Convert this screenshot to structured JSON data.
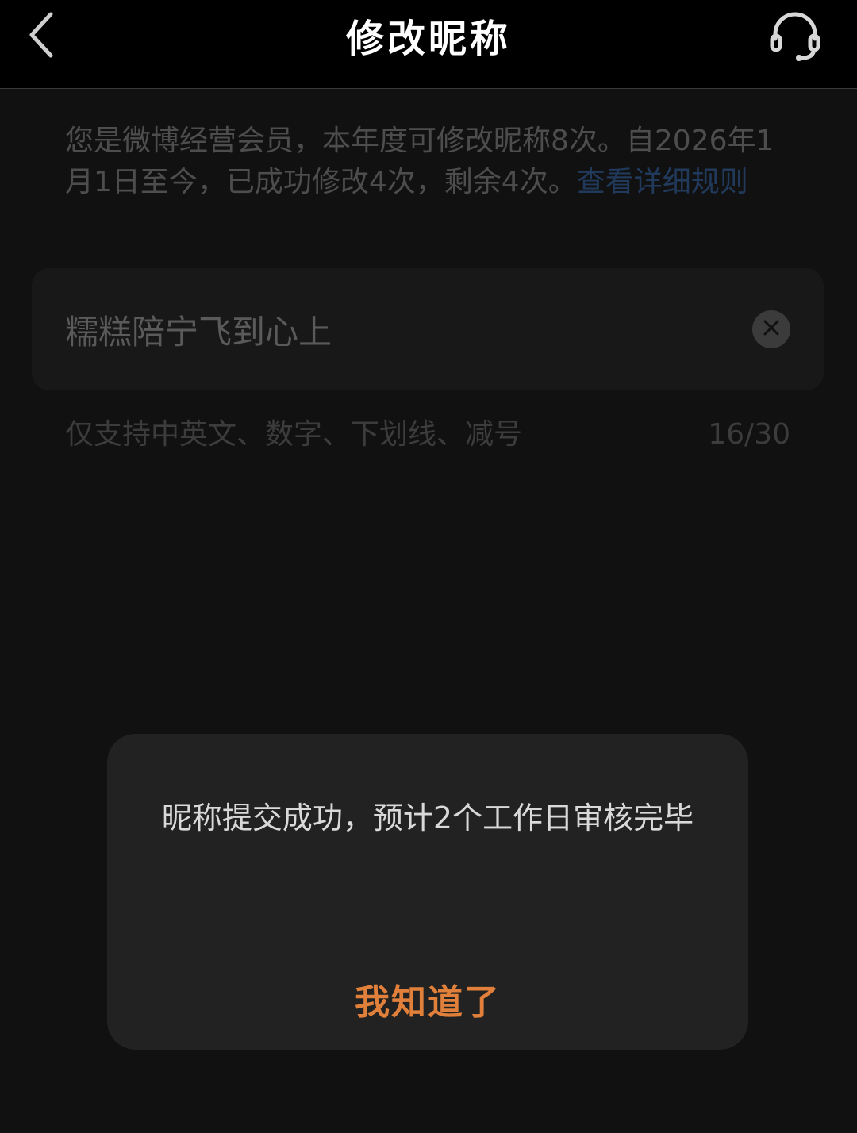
{
  "header": {
    "title": "修改昵称",
    "back_icon": "chevron-left-icon",
    "service_icon": "headset-icon"
  },
  "notice": {
    "text": "您是微博经营会员，本年度可修改昵称8次。自2026年1月1日至今，已成功修改4次，剩余4次。",
    "link_text": "查看详细规则"
  },
  "nickname": {
    "value": "糯糕陪宁飞到心上",
    "clear_icon": "clear-icon"
  },
  "hint": {
    "text": "仅支持中英文、数字、下划线、减号",
    "counter": "16/30"
  },
  "dialog": {
    "message": "昵称提交成功，预计2个工作日审核完毕",
    "confirm_label": "我知道了"
  },
  "colors": {
    "accent": "#e0803a",
    "link": "#213a5c",
    "background": "#111111"
  }
}
